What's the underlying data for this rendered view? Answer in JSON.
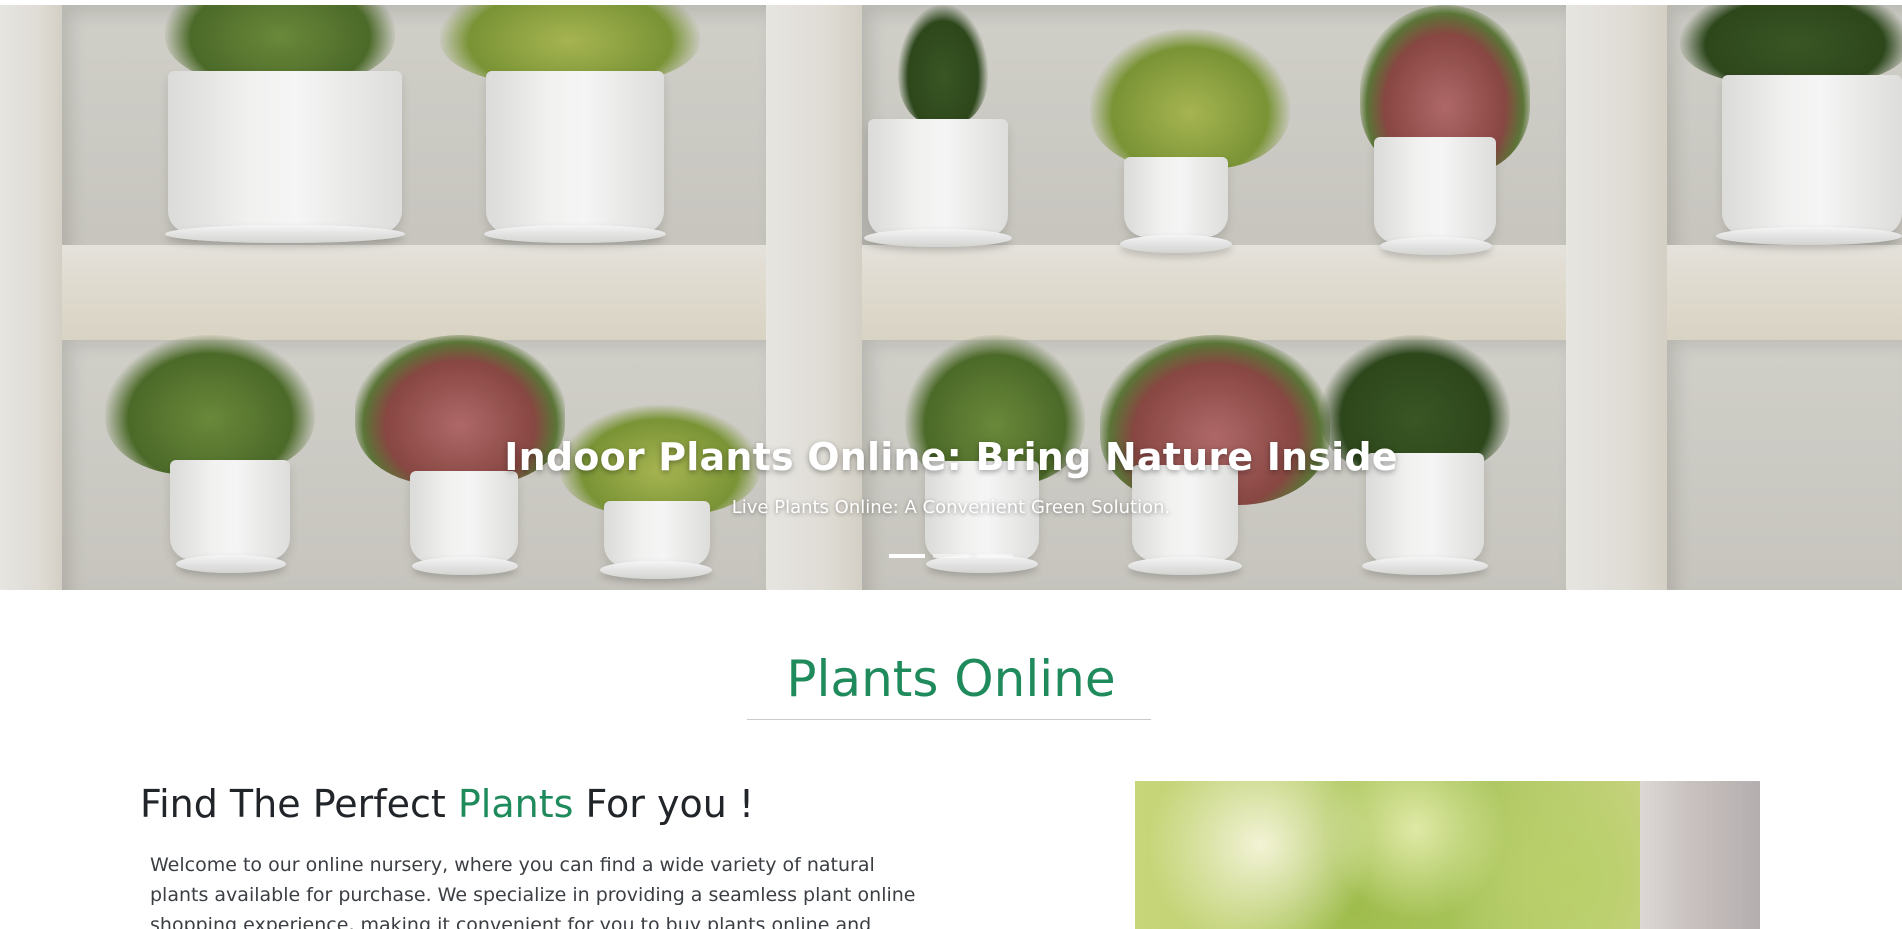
{
  "hero": {
    "title": "Indoor Plants Online: Bring Nature Inside",
    "subtitle": "Live Plants Online: A Convenient Green Solution.",
    "slide_count": 3,
    "active_slide": 1
  },
  "section": {
    "title": "Plants Online"
  },
  "feature": {
    "heading_part1": "Find The Perfect ",
    "heading_accent": "Plants",
    "heading_part2": " For you !",
    "text": "Welcome to our online nursery, where you can find a wide variety of natural plants available for purchase. We specialize in providing a seamless plant online shopping experience, making it convenient for you to buy plants online and have them delivered"
  },
  "colors": {
    "accent": "#1f8a5b",
    "heading": "#212529",
    "body_text": "#3b3f44"
  }
}
